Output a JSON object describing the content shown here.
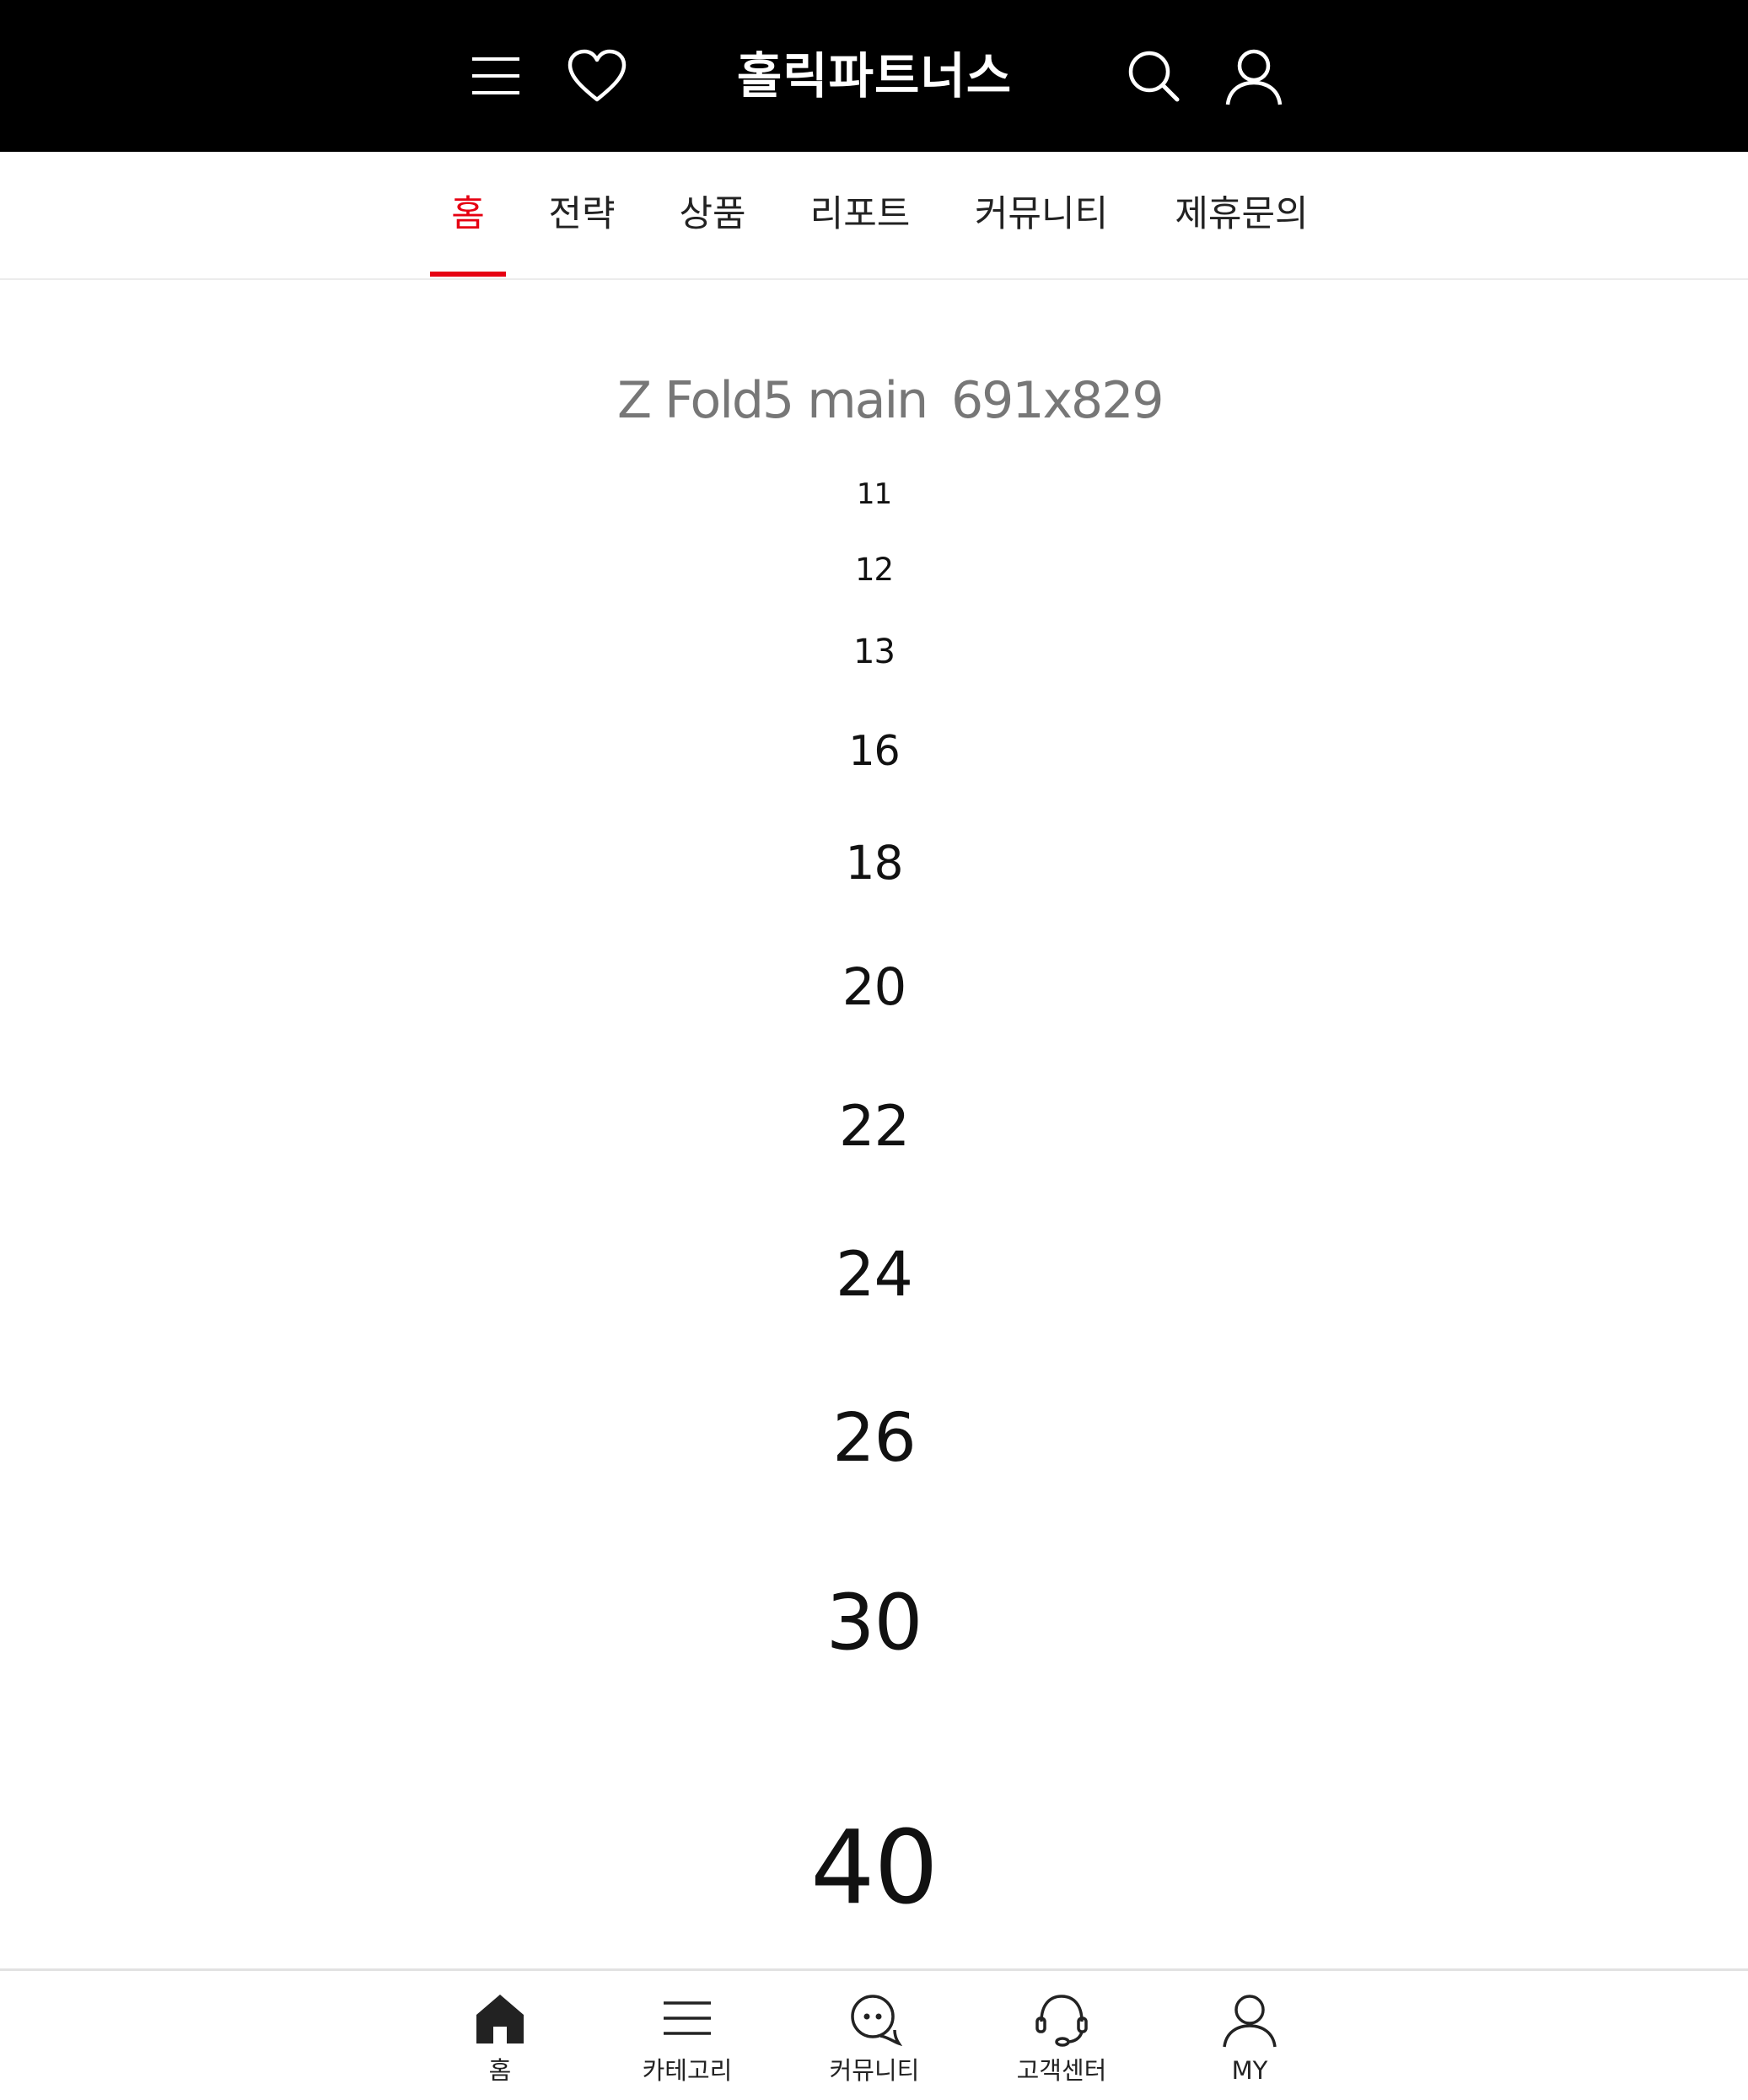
{
  "header": {
    "brand": "홀릭파트너스",
    "icons": [
      "menu-icon",
      "heart-icon",
      "search-icon",
      "user-icon"
    ]
  },
  "nav": {
    "tabs": [
      {
        "label": "홈",
        "active": true
      },
      {
        "label": "전략",
        "active": false
      },
      {
        "label": "상품",
        "active": false
      },
      {
        "label": "리포트",
        "active": false
      },
      {
        "label": "커뮤니티",
        "active": false
      },
      {
        "label": "제휴문의",
        "active": false
      }
    ],
    "accent_color": "#e60012"
  },
  "content": {
    "device_name": "Z Fold5 main",
    "resolution": "691x829",
    "font_sizes": [
      "11",
      "12",
      "13",
      "16",
      "18",
      "20",
      "22",
      "24",
      "26",
      "30",
      "40"
    ]
  },
  "bottom_nav": {
    "items": [
      {
        "label": "홈",
        "icon": "home-icon"
      },
      {
        "label": "카테고리",
        "icon": "menu-icon"
      },
      {
        "label": "커뮤니티",
        "icon": "chat-icon"
      },
      {
        "label": "고객센터",
        "icon": "headset-icon"
      },
      {
        "label": "MY",
        "icon": "user-icon"
      }
    ]
  }
}
